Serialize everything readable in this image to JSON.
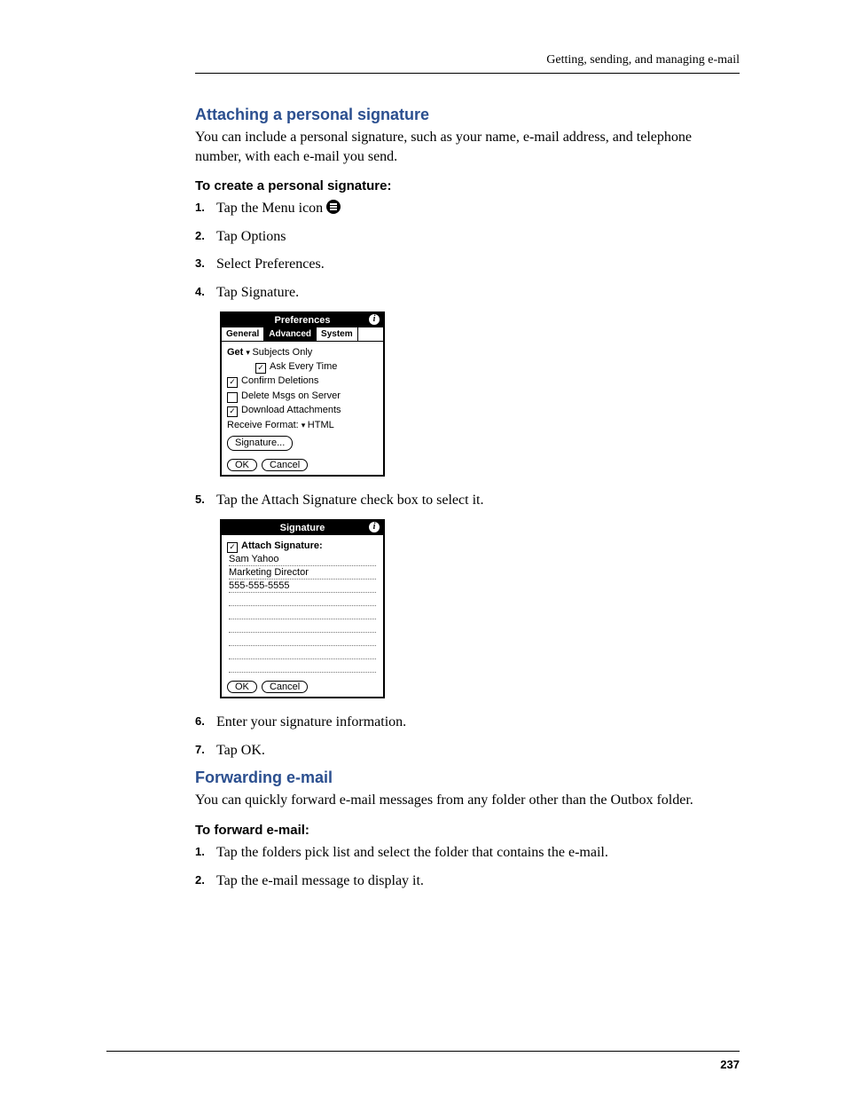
{
  "header": {
    "section_title": "Getting, sending, and managing e-mail"
  },
  "page_number": "237",
  "section1": {
    "heading": "Attaching a personal signature",
    "intro": "You can include a personal signature, such as your name, e-mail address, and telephone number, with each e-mail you send.",
    "subhead": "To create a personal signature:",
    "steps": {
      "s1": "Tap the Menu icon",
      "s2": "Tap Options",
      "s3": "Select Preferences.",
      "s4": "Tap Signature.",
      "s5": "Tap the Attach Signature check box to select it.",
      "s6": "Enter your signature information.",
      "s7": "Tap OK."
    }
  },
  "prefs_dialog": {
    "title": "Preferences",
    "tabs": {
      "general": "General",
      "advanced": "Advanced",
      "system": "System"
    },
    "get_label": "Get",
    "get_value": "Subjects Only",
    "ask_every_time": "Ask Every Time",
    "confirm_deletions": "Confirm Deletions",
    "delete_msgs": "Delete Msgs on Server",
    "download_attachments": "Download Attachments",
    "receive_format_label": "Receive Format:",
    "receive_format_value": "HTML",
    "signature_btn": "Signature...",
    "ok": "OK",
    "cancel": "Cancel"
  },
  "sig_dialog": {
    "title": "Signature",
    "attach_label": "Attach Signature:",
    "line1": "Sam Yahoo",
    "line2": "Marketing Director",
    "line3": "555-555-5555",
    "ok": "OK",
    "cancel": "Cancel"
  },
  "section2": {
    "heading": "Forwarding e-mail",
    "intro": "You can quickly forward e-mail messages from any folder other than the Outbox folder.",
    "subhead": "To forward e-mail:",
    "steps": {
      "s1": "Tap the folders pick list and select the folder that contains the e-mail.",
      "s2": "Tap the e-mail message to display it."
    }
  }
}
